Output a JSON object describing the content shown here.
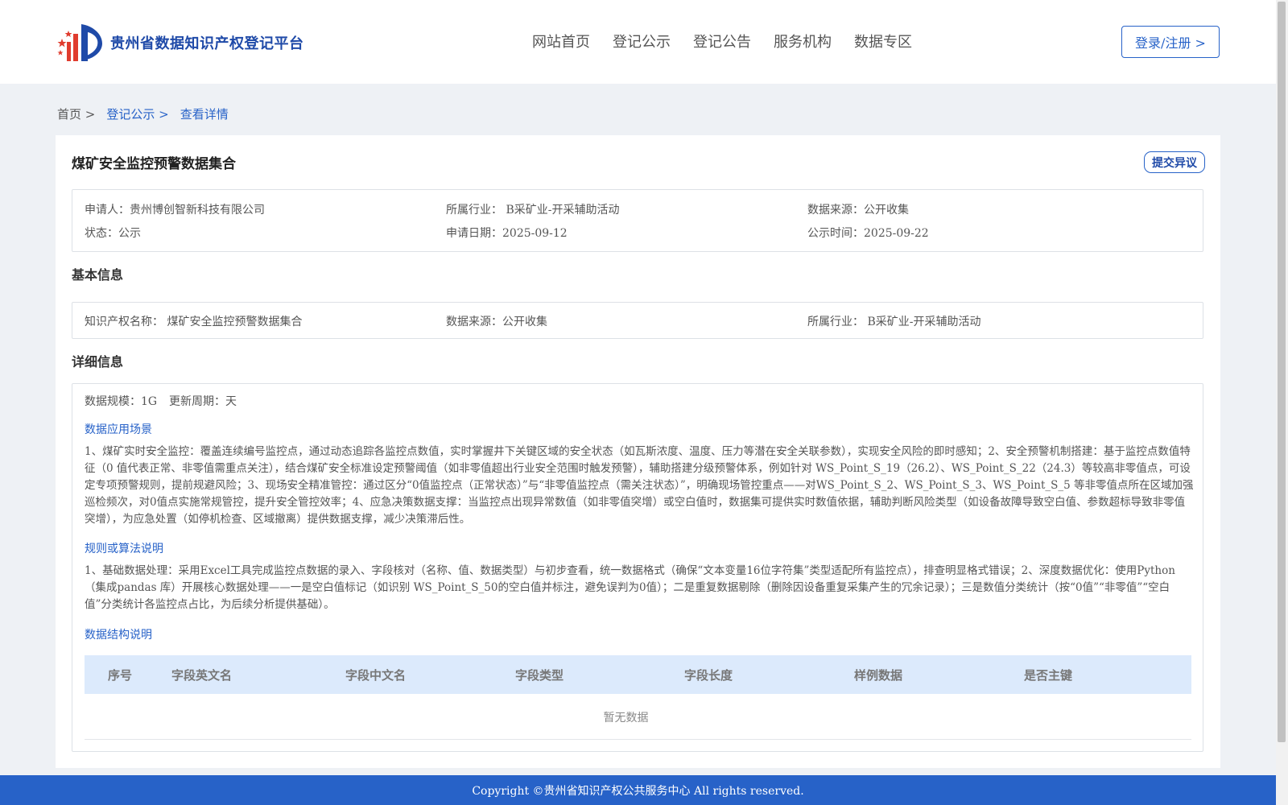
{
  "header": {
    "brand": "贵州省数据知识产权登记平台",
    "nav": [
      "网站首页",
      "登记公示",
      "登记公告",
      "服务机构",
      "数据专区"
    ],
    "login_label": "登录/注册 >"
  },
  "breadcrumb": {
    "home": "首页 >",
    "list": "登记公示 >",
    "current": "查看详情"
  },
  "record": {
    "title": "煤矿安全监控预警数据集合",
    "objection_label": "提交异议",
    "summary": {
      "applicant": "申请人：贵州博创智新科技有限公司",
      "industry": "所属行业： B采矿业-开采辅助活动",
      "source": "数据来源：公开收集",
      "status": "状态：公示",
      "apply_date": "申请日期：2025-09-12",
      "publish_date": "公示时间：2025-09-22"
    }
  },
  "basic_info": {
    "heading": "基本信息",
    "ip_name": "知识产权名称： 煤矿安全监控预警数据集合",
    "source": "数据来源：公开收集",
    "industry": "所属行业： B采矿业-开采辅助活动"
  },
  "detail_info": {
    "heading": "详细信息",
    "scale": "数据规模：1G",
    "cycle": "更新周期：天",
    "scenario_title": "数据应用场景",
    "scenario_text": "1、煤矿实时安全监控：覆盖连续编号监控点，通过动态追踪各监控点数值，实时掌握井下关键区域的安全状态（如瓦斯浓度、温度、压力等潜在安全关联参数），实现安全风险的即时感知；2、安全预警机制搭建：基于监控点数值特征（0 值代表正常、非零值需重点关注），结合煤矿安全标准设定预警阈值（如非零值超出行业安全范围时触发预警），辅助搭建分级预警体系，例如针对 WS_Point_S_19（26.2）、WS_Point_S_22（24.3）等较高非零值点，可设定专项预警规则，提前规避风险；3、现场安全精准管控：通过区分“0值监控点（正常状态）”与“非零值监控点（需关注状态）”，明确现场管控重点——对WS_Point_S_2、WS_Point_S_3、WS_Point_S_5 等非零值点所在区域加强巡检频次，对0值点实施常规管控，提升安全管控效率；4、应急决策数据支撑：当监控点出现异常数值（如非零值突增）或空白值时，数据集可提供实时数值依据，辅助判断风险类型（如设备故障导致空白值、参数超标导致非零值突增），为应急处置（如停机检查、区域撤离）提供数据支撑，减少决策滞后性。",
    "rule_title": "规则或算法说明",
    "rule_text": "1、基础数据处理：采用Excel工具完成监控点数据的录入、字段核对（名称、值、数据类型）与初步查看，统一数据格式（确保“文本变量16位字符集”类型适配所有监控点），排查明显格式错误；2、深度数据优化：使用Python（集成pandas 库）开展核心数据处理——一是空白值标记（如识别 WS_Point_S_50的空白值并标注，避免误判为0值）；二是重复数据剔除（删除因设备重复采集产生的冗余记录）；三是数值分类统计（按“0值”“非零值”“空白值”分类统计各监控点占比，为后续分析提供基础）。",
    "structure_title": "数据结构说明",
    "table_headers": [
      "序号",
      "字段英文名",
      "字段中文名",
      "字段类型",
      "字段长度",
      "样例数据",
      "是否主键"
    ],
    "empty_text": "暂无数据"
  },
  "footer": {
    "copyright": "Copyright ©贵州省知识产权公共服务中心 All rights reserved."
  },
  "colors": {
    "brand_blue": "#2762c8",
    "header_bg": "#dceafc"
  }
}
